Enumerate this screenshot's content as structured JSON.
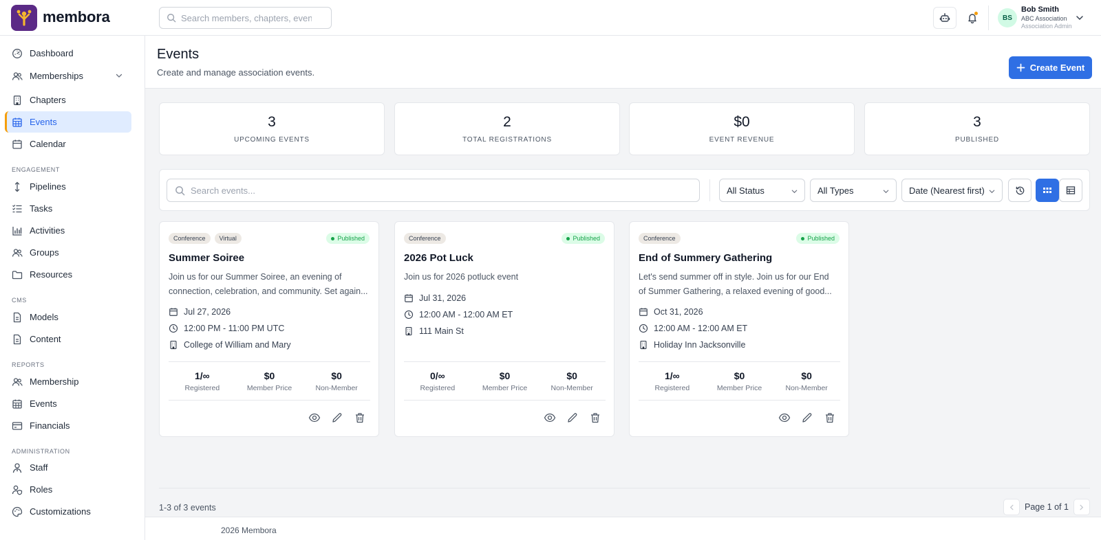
{
  "app": {
    "brand": "membora"
  },
  "header": {
    "search_placeholder": "Search members, chapters, events",
    "user": {
      "initials": "BS",
      "name": "Bob Smith",
      "org": "ABC Association",
      "role": "Association Admin"
    }
  },
  "sidebar": {
    "items": [
      {
        "label": "Dashboard",
        "icon": "dashboard-icon"
      },
      {
        "label": "Memberships",
        "icon": "users-icon"
      },
      {
        "label": "Chapters",
        "icon": "building-icon"
      },
      {
        "label": "Events",
        "icon": "calendar-grid-icon",
        "active": true
      },
      {
        "label": "Calendar",
        "icon": "calendar-icon"
      }
    ],
    "sections": [
      {
        "label": "ENGAGEMENT",
        "items": [
          {
            "label": "Pipelines",
            "icon": "arrows-vertical-icon"
          },
          {
            "label": "Tasks",
            "icon": "list-check-icon"
          },
          {
            "label": "Activities",
            "icon": "bar-chart-icon"
          },
          {
            "label": "Groups",
            "icon": "users-icon"
          },
          {
            "label": "Resources",
            "icon": "folder-icon"
          }
        ]
      },
      {
        "label": "CMS",
        "items": [
          {
            "label": "Models",
            "icon": "document-icon"
          },
          {
            "label": "Content",
            "icon": "document-icon"
          }
        ]
      },
      {
        "label": "REPORTS",
        "items": [
          {
            "label": "Membership",
            "icon": "users-icon"
          },
          {
            "label": "Events",
            "icon": "calendar-grid-icon"
          },
          {
            "label": "Financials",
            "icon": "credit-card-icon"
          }
        ]
      },
      {
        "label": "ADMINISTRATION",
        "items": [
          {
            "label": "Staff",
            "icon": "user-tie-icon"
          },
          {
            "label": "Roles",
            "icon": "user-shield-icon"
          },
          {
            "label": "Customizations",
            "icon": "palette-icon"
          }
        ]
      }
    ]
  },
  "page": {
    "title": "Events",
    "subtitle": "Create and manage association events.",
    "create_label": "Create Event"
  },
  "stats": [
    {
      "value": "3",
      "label": "UPCOMING EVENTS"
    },
    {
      "value": "2",
      "label": "TOTAL REGISTRATIONS"
    },
    {
      "value": "$0",
      "label": "EVENT REVENUE"
    },
    {
      "value": "3",
      "label": "PUBLISHED"
    }
  ],
  "filters": {
    "search_placeholder": "Search events...",
    "status": "All Status",
    "type": "All Types",
    "sort": "Date (Nearest first)"
  },
  "events": [
    {
      "tags": [
        "Conference",
        "Virtual"
      ],
      "status": "Published",
      "title": "Summer Soiree",
      "desc_line1": "Join us for our Summer Soiree, an evening of",
      "desc_line2": "connection, celebration, and community. Set again...",
      "date": "Jul 27, 2026",
      "time": "12:00 PM - 11:00 PM UTC",
      "location": "College of William and Mary",
      "registered": "1/∞",
      "registered_label": "Registered",
      "member_price": "$0",
      "member_price_label": "Member Price",
      "non_member_price": "$0",
      "non_member_label": "Non-Member"
    },
    {
      "tags": [
        "Conference"
      ],
      "status": "Published",
      "title": "2026 Pot Luck",
      "desc_line1": "Join us for 2026 potluck event",
      "desc_line2": "",
      "date": "Jul 31, 2026",
      "time": "12:00 AM - 12:00 AM ET",
      "location": "111 Main St",
      "registered": "0/∞",
      "registered_label": "Registered",
      "member_price": "$0",
      "member_price_label": "Member Price",
      "non_member_price": "$0",
      "non_member_label": "Non-Member"
    },
    {
      "tags": [
        "Conference"
      ],
      "status": "Published",
      "title": "End of Summery Gathering",
      "desc_line1": "Let's send summer off in style. Join us for our End",
      "desc_line2": "of Summer Gathering, a relaxed evening of good...",
      "date": "Oct 31, 2026",
      "time": "12:00 AM - 12:00 AM ET",
      "location": "Holiday Inn Jacksonville",
      "registered": "1/∞",
      "registered_label": "Registered",
      "member_price": "$0",
      "member_price_label": "Member Price",
      "non_member_price": "$0",
      "non_member_label": "Non-Member"
    }
  ],
  "pagination": {
    "summary": "1-3 of 3 events",
    "page_label": "Page 1 of 1"
  },
  "footer": {
    "copyright": "2026 Membora"
  },
  "colors": {
    "primary": "#2f6fe4",
    "brand_logo": "#5b2a86",
    "accent": "#f59e0b",
    "published": "#16a34a"
  }
}
